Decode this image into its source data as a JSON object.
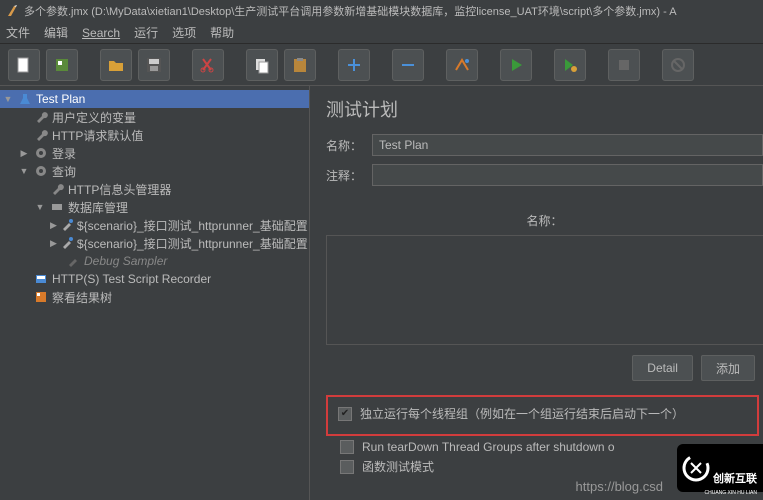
{
  "window": {
    "title": "多个参数.jmx (D:\\MyData\\xietian1\\Desktop\\生产测试平台调用参数新增基础模块数据库，监控license_UAT环境\\script\\多个参数.jmx) - A"
  },
  "menu": {
    "file": "文件",
    "edit": "编辑",
    "search": "Search",
    "run": "运行",
    "options": "选项",
    "help": "帮助"
  },
  "tree": {
    "n0": "Test Plan",
    "n1": "用户定义的变量",
    "n2": "HTTP请求默认值",
    "n3": "登录",
    "n4": "查询",
    "n5": "HTTP信息头管理器",
    "n6": "数据库管理",
    "n7": "${scenario}_接口测试_httprunner_基础配置",
    "n8": "${scenario}_接口测试_httprunner_基础配置",
    "n9": "Debug Sampler",
    "n10": "HTTP(S) Test Script Recorder",
    "n11": "察看结果树"
  },
  "plan": {
    "heading": "测试计划",
    "name_label": "名称：",
    "name_value": "Test Plan",
    "comment_label": "注释：",
    "comment_value": "",
    "sub_name": "名称：",
    "btn_detail": "Detail",
    "btn_add": "添加",
    "chk1": "独立运行每个线程组（例如在一个组运行结束后启动下一个）",
    "chk2": "Run tearDown Thread Groups after shutdown o",
    "chk3": "函数测试模式"
  },
  "watermark": "https://blog.csd",
  "logo": {
    "brand": "创新互联",
    "sub": "CHUANG XIN HU LIAN"
  }
}
